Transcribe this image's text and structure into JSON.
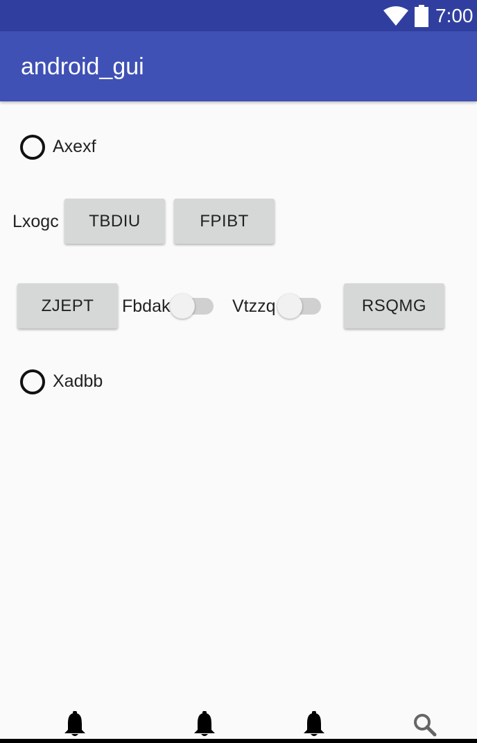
{
  "status_bar": {
    "time": "7:00",
    "icons": [
      "wifi-icon",
      "battery-icon"
    ]
  },
  "app_bar": {
    "title": "android_gui"
  },
  "main": {
    "radio_1": {
      "label": "Axexf",
      "checked": false
    },
    "row_1": {
      "label": "Lxogc",
      "buttons": [
        "TBDIU",
        "FPIBT"
      ]
    },
    "row_2": {
      "button_left": "ZJEPT",
      "switch_1": {
        "label": "Fbdak",
        "on": false
      },
      "switch_2": {
        "label": "Vtzzq",
        "on": false
      },
      "button_right": "RSQMG"
    },
    "radio_2": {
      "label": "Xadbb",
      "checked": false
    }
  },
  "bottom_bar": {
    "icons": [
      "bell-icon",
      "bell-icon",
      "bell-icon",
      "search-icon"
    ]
  },
  "colors": {
    "status_bar": "#303f9f",
    "app_bar": "#3f51b5",
    "button": "#d6d7d7",
    "background": "#fafafa"
  }
}
